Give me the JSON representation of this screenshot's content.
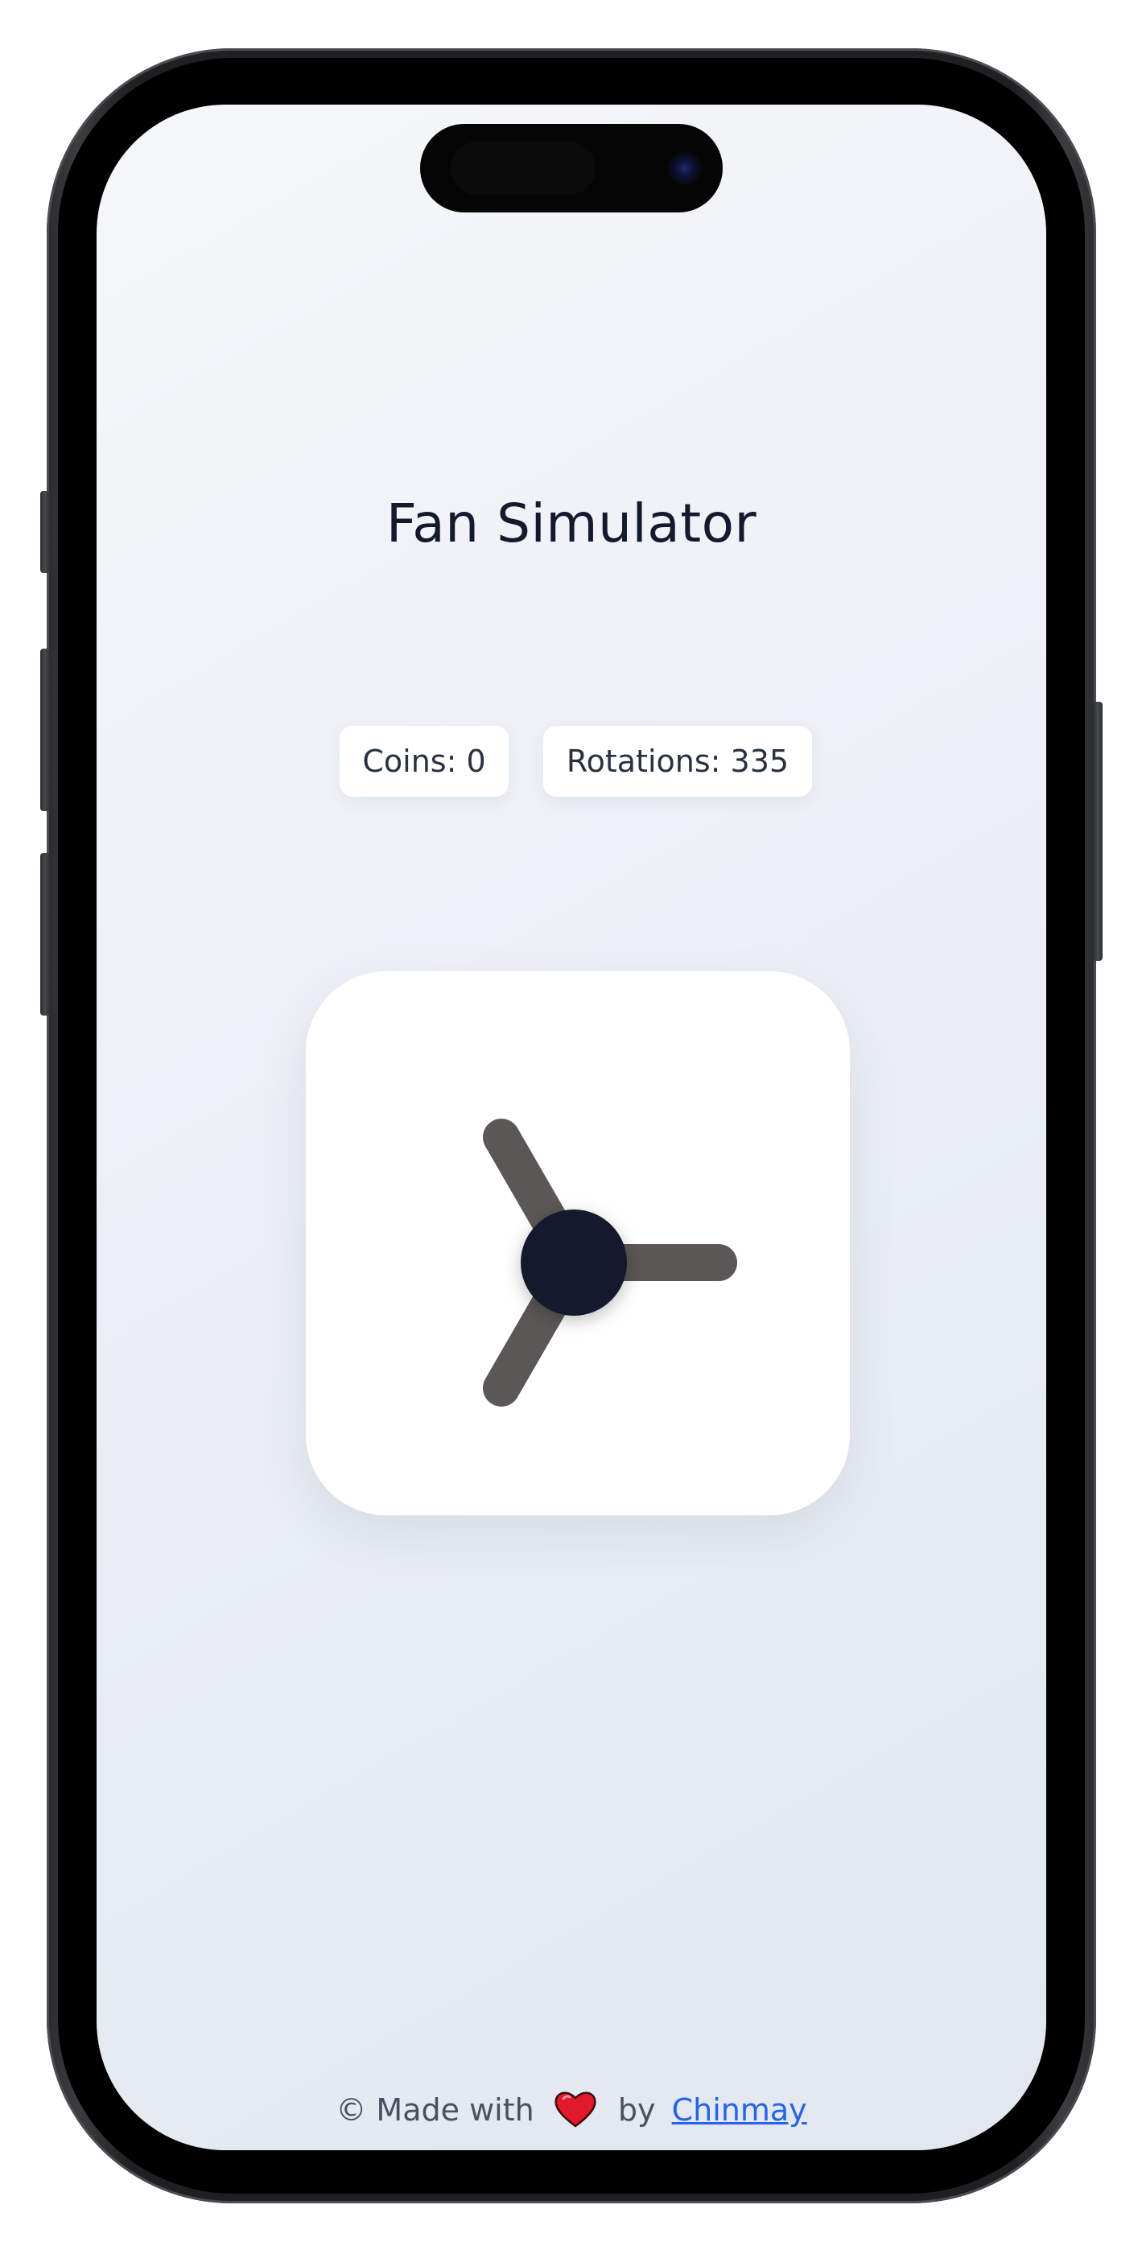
{
  "app": {
    "title": "Fan Simulator"
  },
  "stats": {
    "coins_label": "Coins: 0",
    "rotations_label": "Rotations: 335"
  },
  "fan": {
    "blade_color": "#5b5757",
    "hub_color": "#121a2c",
    "blade_count": 3
  },
  "footer": {
    "prefix": "© Made with",
    "by": "by",
    "author_link": "Chinmay",
    "heart_icon": "heart-icon"
  },
  "colors": {
    "title": "#141a2e",
    "link": "#2563eb",
    "heart": "#e0192b"
  }
}
